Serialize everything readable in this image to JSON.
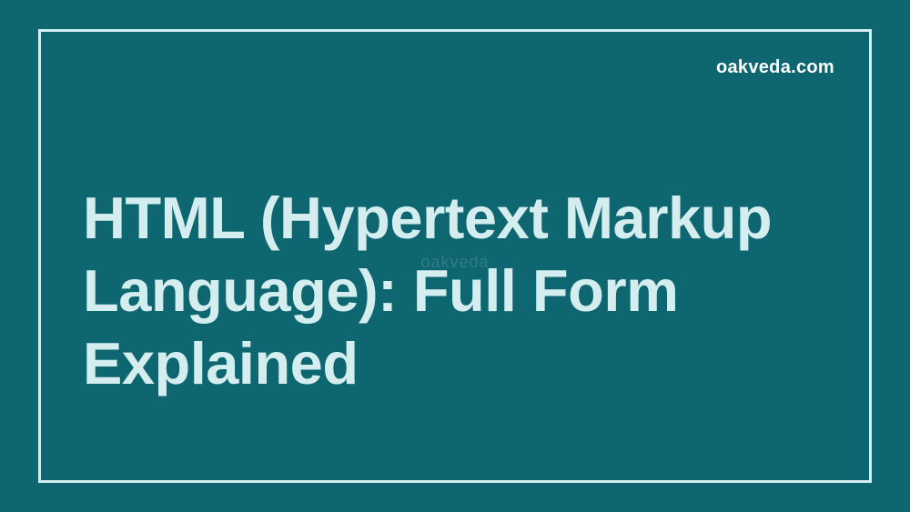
{
  "brand": "oakveda.com",
  "title": "HTML (Hypertext Markup Language): Full Form Explained",
  "watermark": "oakveda",
  "colors": {
    "background": "#0d6670",
    "text": "#d4eef0",
    "brand": "#ffffff"
  }
}
